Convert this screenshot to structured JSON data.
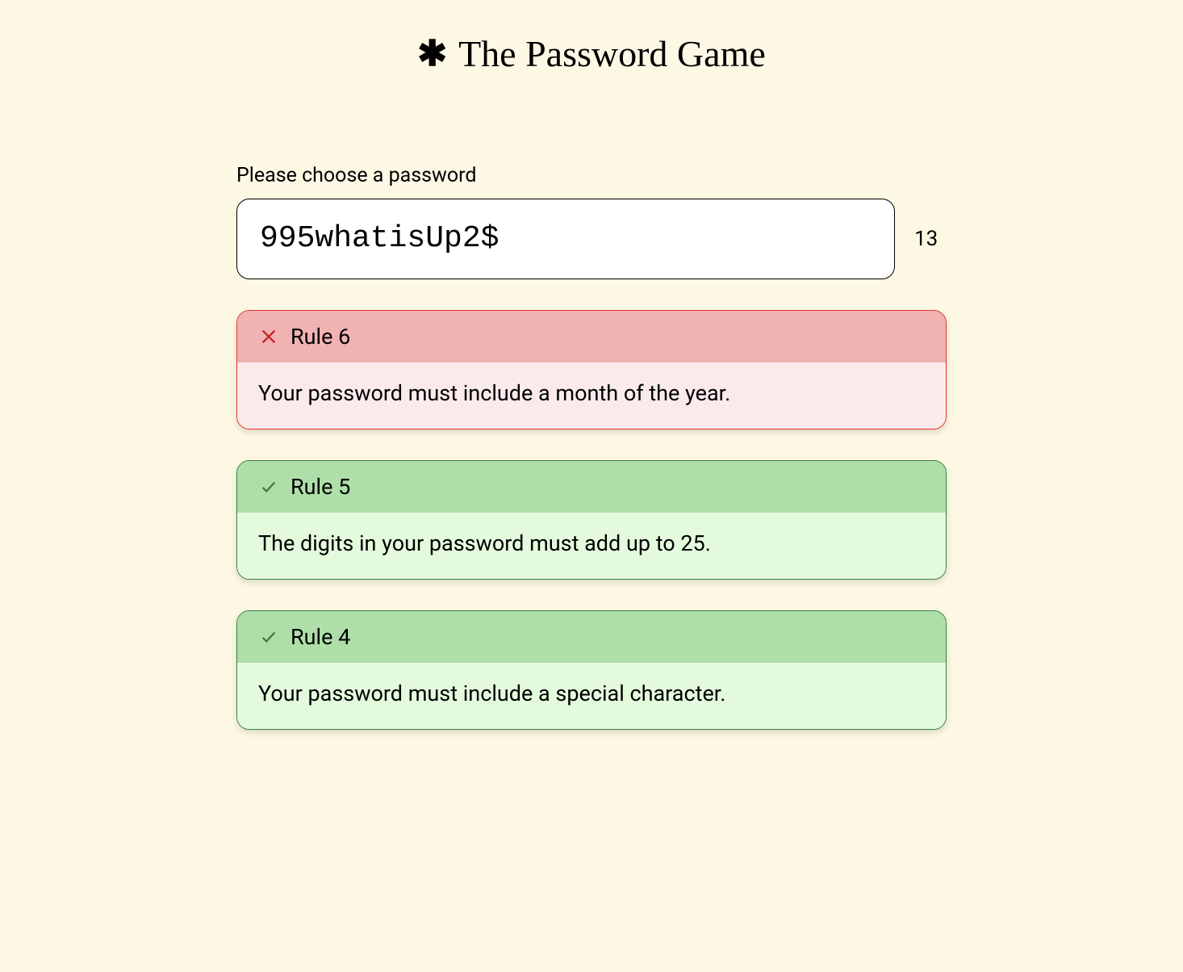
{
  "title": "The Password Game",
  "prompt_label": "Please choose a password",
  "password_value": "995whatisUp2$",
  "char_count": "13",
  "rules": [
    {
      "status": "fail",
      "label": "Rule 6",
      "description": "Your password must include a month of the year."
    },
    {
      "status": "pass",
      "label": "Rule 5",
      "description": "The digits in your password must add up to 25."
    },
    {
      "status": "pass",
      "label": "Rule 4",
      "description": "Your password must include a special character."
    }
  ]
}
